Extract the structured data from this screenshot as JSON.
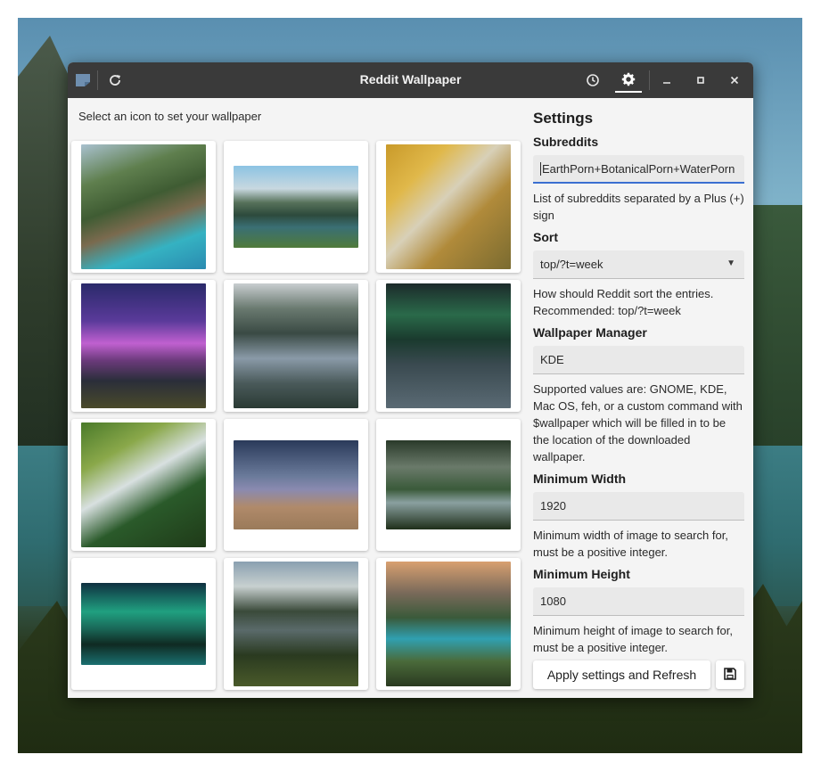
{
  "window": {
    "title": "Reddit Wallpaper",
    "icons": {
      "app": "sticky-note-icon",
      "refresh": "refresh-icon",
      "history": "clock-icon",
      "settings": "gear-icon",
      "minimize": "minimize-icon",
      "maximize": "maximize-icon",
      "close": "close-icon"
    }
  },
  "gallery": {
    "hint": "Select an icon to set your wallpaper"
  },
  "settings": {
    "heading": "Settings",
    "subreddits": {
      "label": "Subreddits",
      "value": "EarthPorn+BotanicalPorn+WaterPorn",
      "help": "List of subreddits separated by a Plus (+) sign"
    },
    "sort": {
      "label": "Sort",
      "value": "top/?t=week",
      "help": "How should Reddit sort the entries. Recommended: top/?t=week"
    },
    "manager": {
      "label": "Wallpaper Manager",
      "value": "KDE",
      "help": "Supported values are: GNOME, KDE, Mac OS, feh, or a custom command with $wallpaper which will be filled in to be the location of the downloaded wallpaper."
    },
    "min_width": {
      "label": "Minimum Width",
      "value": "1920",
      "help": "Minimum width of image to search for, must be a positive integer."
    },
    "min_height": {
      "label": "Minimum Height",
      "value": "1080",
      "help": "Minimum height of image to search for, must be a positive integer."
    },
    "apply_label": "Apply settings and Refresh",
    "save_icon": "floppy-disk-icon"
  },
  "colors": {
    "titlebar": "#3a3a3a",
    "window_bg": "#f4f4f4",
    "focus_accent": "#3b6fd1"
  }
}
